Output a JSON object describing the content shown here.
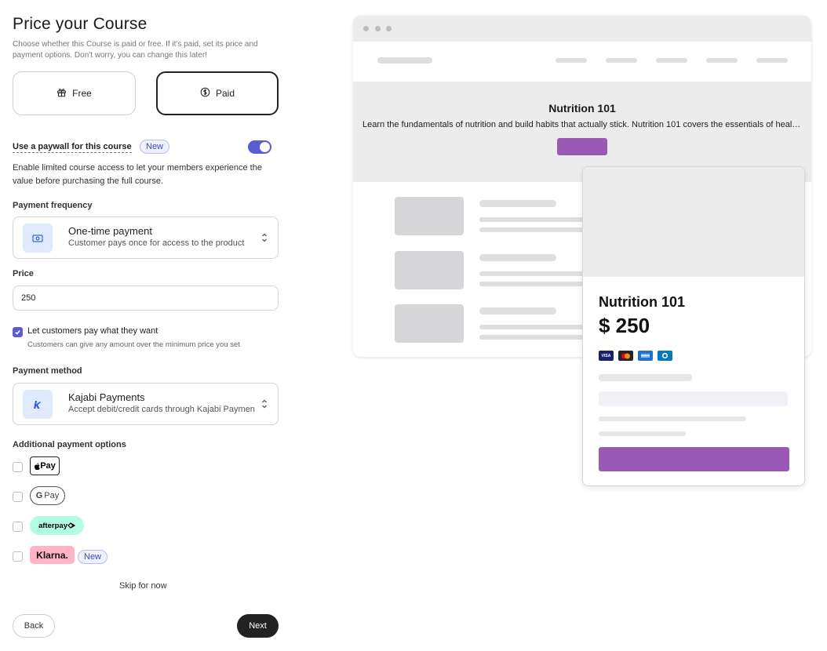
{
  "header": {
    "title": "Price your Course",
    "subtitle": "Choose whether this Course is paid or free. If it's paid, set its price and payment options. Don't worry, you can change this later!"
  },
  "pricing_type": {
    "free_label": "Free",
    "paid_label": "Paid",
    "selected": "Paid",
    "free_icon": "gift-icon",
    "paid_icon": "dollar-circle-icon"
  },
  "paywall": {
    "label": "Use a paywall for this course",
    "badge": "New",
    "enabled": true,
    "description": "Enable limited course access to let your members experience the value before purchasing the full course."
  },
  "payment_frequency": {
    "label": "Payment frequency",
    "selected_title": "One-time payment",
    "selected_subtitle": "Customer pays once for access to the product",
    "icon": "cash-icon"
  },
  "price": {
    "label": "Price",
    "value": "250"
  },
  "pay_what_you_want": {
    "checked": true,
    "title": "Let customers pay what they want",
    "subtitle": "Customers can give any amount over the minimum price you set"
  },
  "payment_method": {
    "label": "Payment method",
    "selected_title": "Kajabi Payments",
    "selected_subtitle": "Accept debit/credit cards through Kajabi Payments",
    "icon": "kajabi-logo-icon"
  },
  "additional_options": {
    "label": "Additional payment options",
    "items": [
      {
        "name": "Apple Pay",
        "logo_text": "Pay",
        "checked": false
      },
      {
        "name": "Google Pay",
        "logo_g": "G",
        "logo_text": "Pay",
        "checked": false
      },
      {
        "name": "Afterpay",
        "logo_text": "afterpay",
        "checked": false
      },
      {
        "name": "Klarna",
        "logo_text": "Klarna.",
        "badge": "New",
        "checked": false
      }
    ]
  },
  "footer": {
    "skip_label": "Skip for now",
    "back_label": "Back",
    "next_label": "Next"
  },
  "preview": {
    "hero_title": "Nutrition 101",
    "hero_description": "Learn the fundamentals of nutrition and build habits that actually stick. Nutrition 101 covers the essentials of healthy eating",
    "product_name": "Nutrition 101",
    "product_price": "$ 250",
    "card_icons": [
      "visa-icon",
      "mastercard-icon",
      "amex-icon",
      "diners-icon"
    ],
    "visa_text": "VISA"
  },
  "colors": {
    "accent": "#5b5bd6",
    "preview_button": "#9b59b6",
    "dark_button": "#222222",
    "afterpay_bg": "#b2fce4",
    "klarna_bg": "#ffb3c7"
  }
}
